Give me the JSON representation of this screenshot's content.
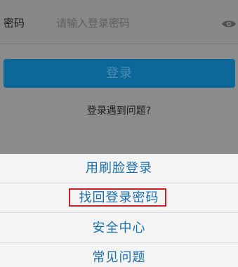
{
  "form": {
    "password_label": "密码",
    "password_placeholder": "请输入登录密码",
    "login_button": "登录",
    "help_link": "登录遇到问题?"
  },
  "sheet": {
    "items": [
      {
        "label": "用刷脸登录"
      },
      {
        "label": "找回登录密码"
      },
      {
        "label": "安全中心"
      },
      {
        "label": "常见问题"
      }
    ]
  },
  "colors": {
    "accent": "#1a6fb3",
    "highlight_border": "#c8202a",
    "login_button_dimmed": "#0d6799"
  },
  "icons": {
    "password_toggle": "eye-icon"
  }
}
